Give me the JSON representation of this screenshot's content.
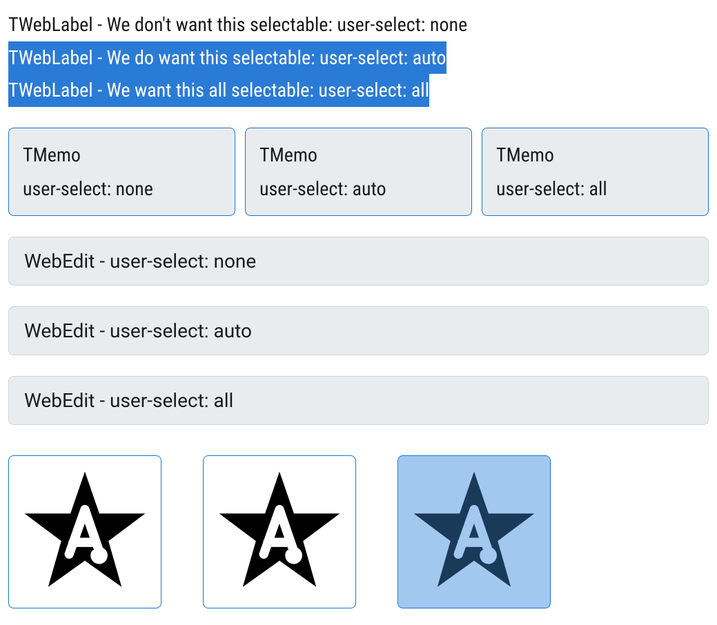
{
  "labels": {
    "none": "TWebLabel - We don't want this selectable: user-select: none",
    "auto": "TWebLabel - We do want this selectable: user-select: auto",
    "all": "TWebLabel - We want this all selectable: user-select: all"
  },
  "memos": [
    {
      "title": "TMemo",
      "sub": "user-select: none",
      "mode": "none"
    },
    {
      "title": "TMemo",
      "sub": "user-select: auto",
      "mode": "auto"
    },
    {
      "title": "TMemo",
      "sub": "user-select: all",
      "mode": "all"
    }
  ],
  "edits": [
    {
      "value": "WebEdit - user-select: none",
      "mode": "none"
    },
    {
      "value": "WebEdit - user-select: auto",
      "mode": "auto"
    },
    {
      "value": "WebEdit - user-select: all",
      "mode": "all"
    }
  ],
  "images": [
    {
      "mode": "none",
      "selected": false
    },
    {
      "mode": "auto",
      "selected": false
    },
    {
      "mode": "all",
      "selected": true
    }
  ],
  "icon_name": "star-letter-a-icon"
}
